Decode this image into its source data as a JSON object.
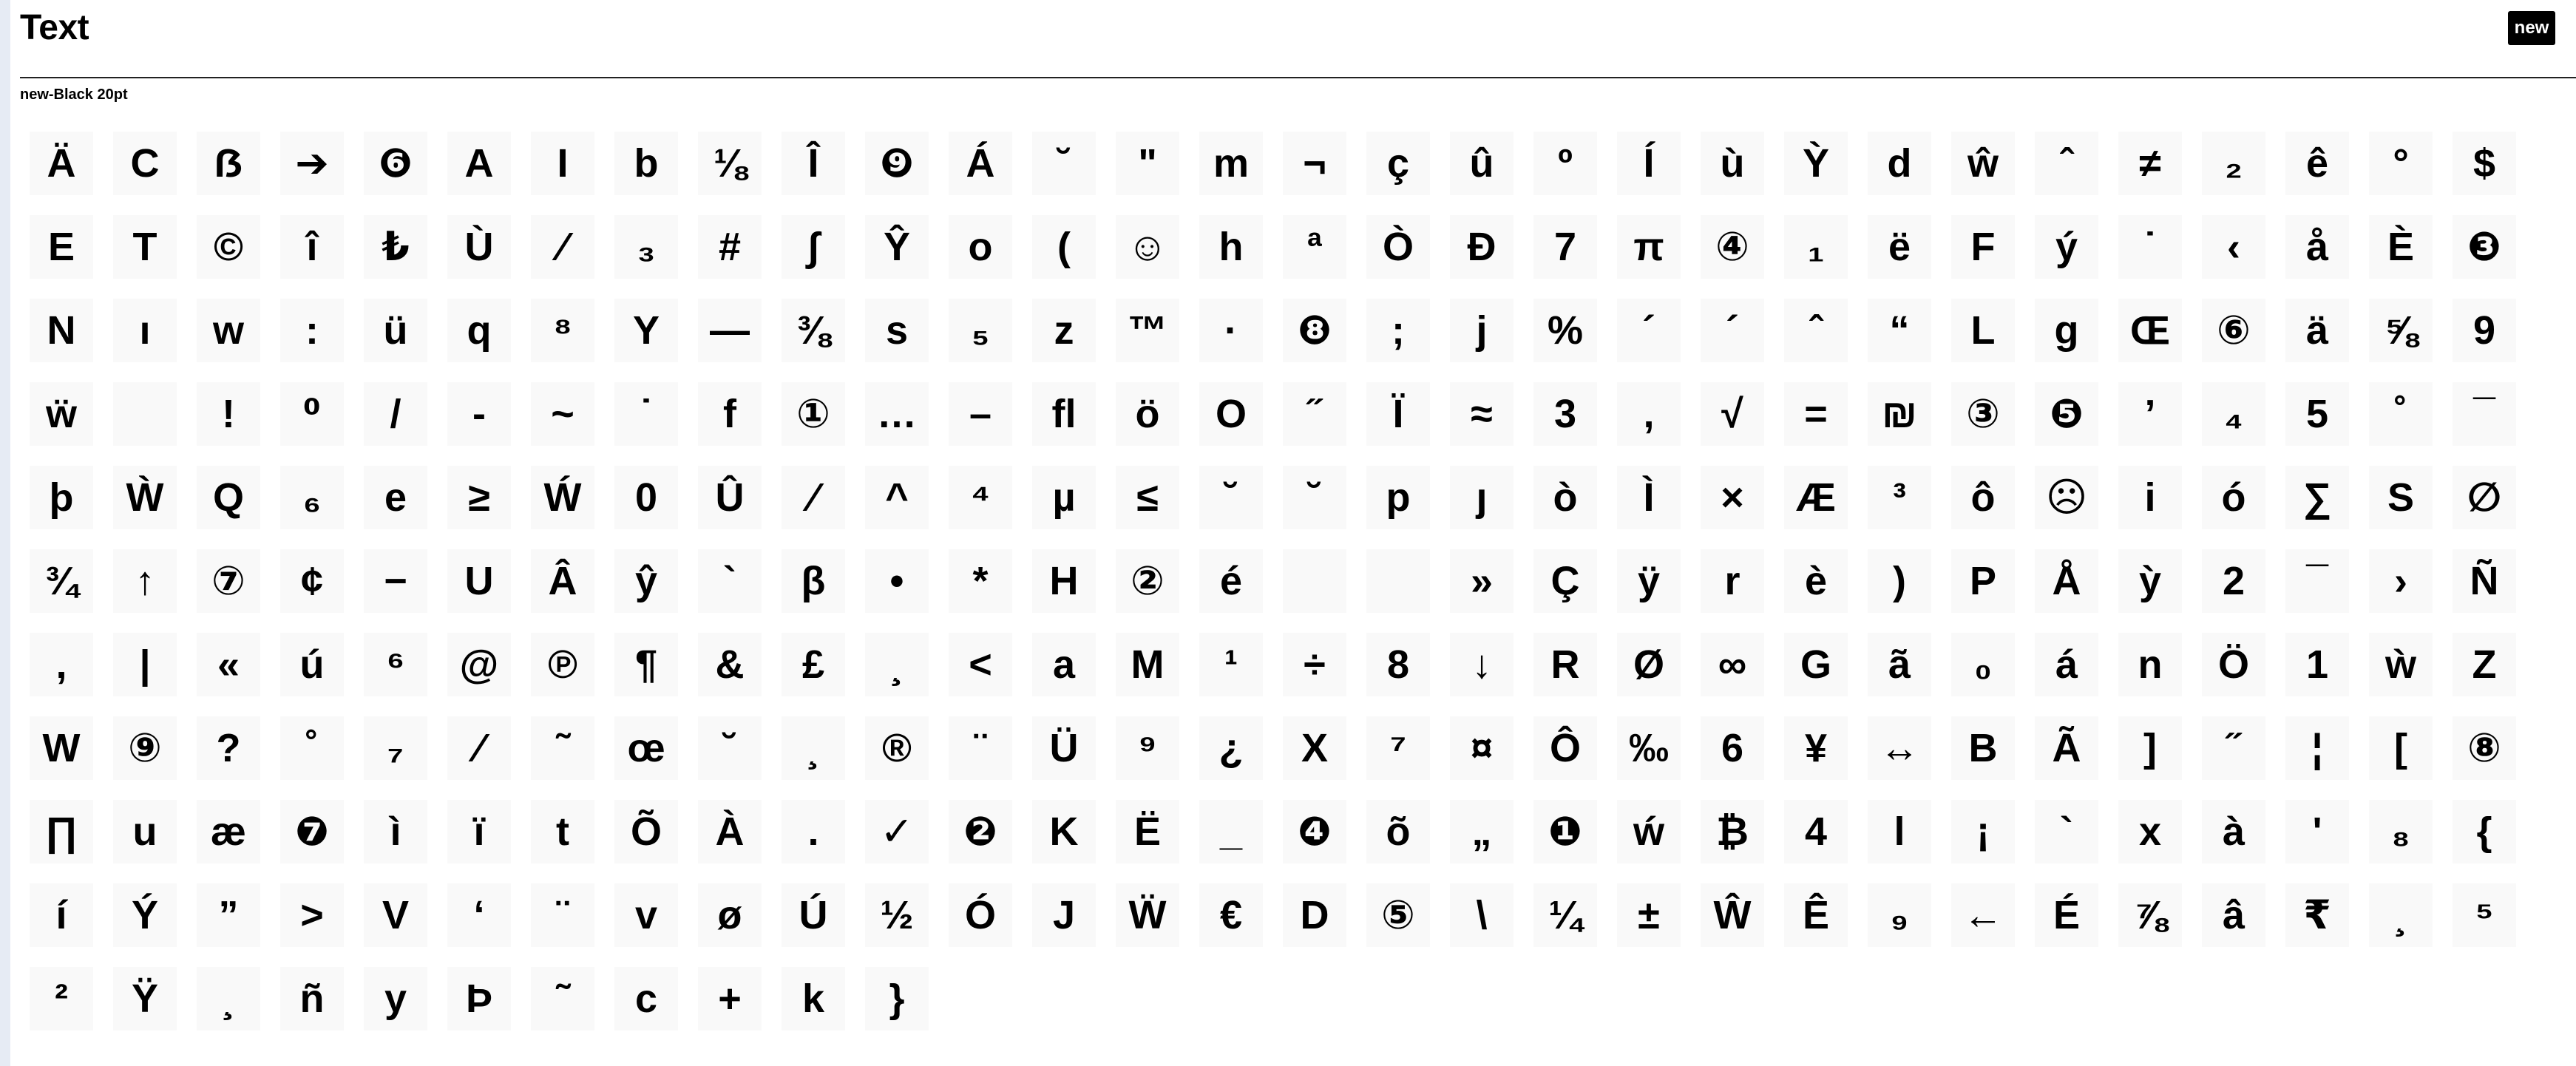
{
  "header": {
    "title": "Text",
    "badge_label": "new"
  },
  "font_label": "new-Black 20pt",
  "glyphs": [
    "Ä",
    "C",
    "ẞ",
    "➔",
    "❻",
    "A",
    "I",
    "b",
    "⅛",
    "Î",
    "❾",
    "Á",
    "˘",
    "\"",
    "m",
    "¬",
    "ç",
    "û",
    "º",
    "Í",
    "ù",
    "Ỳ",
    "d",
    "ŵ",
    "ˆ",
    "≠",
    "₂",
    "ê",
    "°",
    "$",
    "E",
    "T",
    "©",
    "î",
    "₺",
    "Ù",
    "⁄",
    "₃",
    "#",
    "∫",
    "Ŷ",
    "o",
    "(",
    "☺",
    "h",
    "ª",
    "Ò",
    "Đ",
    "7",
    "π",
    "④",
    "₁",
    "ë",
    "F",
    "ý",
    "˙",
    "‹",
    "å",
    "È",
    "❸",
    "N",
    "ı",
    "w",
    ":",
    "ü",
    "q",
    "⁸",
    "Y",
    "—",
    "⅜",
    "s",
    "₅",
    "z",
    "™",
    "·",
    "❽",
    ";",
    "j",
    "%",
    "´",
    "´",
    "ˆ",
    "“",
    "L",
    "g",
    "Œ",
    "⑥",
    "ä",
    "⅝",
    "9",
    "ẅ",
    " ",
    "!",
    "⁰",
    "/",
    "-",
    "~",
    "˙",
    "f",
    "①",
    "…",
    "–",
    "ﬂ",
    "ö",
    "O",
    "˝",
    "Ï",
    "≈",
    "3",
    ",",
    "√",
    "=",
    "₪",
    "③",
    "❺",
    "’",
    "₄",
    "5",
    "˚",
    "¯",
    "þ",
    "Ẁ",
    "Q",
    "₆",
    "e",
    "≥",
    "Ẃ",
    "0",
    "Û",
    "⁄",
    "^",
    "⁴",
    "µ",
    "≤",
    "˘",
    "˘",
    "p",
    "ȷ",
    "ò",
    "Ì",
    "×",
    "Æ",
    "³",
    "ô",
    "☹",
    "i",
    "ó",
    "∑",
    "S",
    "∅",
    "¾",
    "↑",
    "⑦",
    "¢",
    "−",
    "U",
    "Â",
    "ŷ",
    "`",
    "β",
    "•",
    "*",
    "H",
    "②",
    "é",
    " ",
    " ",
    "»",
    "Ç",
    "ÿ",
    "r",
    "è",
    ")",
    "P",
    "Å",
    "ỳ",
    "2",
    "¯",
    "›",
    "Ñ",
    ",",
    "|",
    "«",
    "ú",
    "⁶",
    "@",
    "℗",
    "¶",
    "&",
    "£",
    "¸",
    "<",
    "a",
    "M",
    "¹",
    "÷",
    "8",
    "↓",
    "R",
    "Ø",
    "∞",
    "G",
    "ã",
    "₀",
    "á",
    "n",
    "Ö",
    "1",
    "ẁ",
    "Z",
    "W",
    "⑨",
    "?",
    "˚",
    "₇",
    "⁄",
    "˜",
    "œ",
    "˘",
    "¸",
    "®",
    "¨",
    "Ü",
    "⁹",
    "¿",
    "X",
    "⁷",
    "¤",
    "Ô",
    "‰",
    "6",
    "¥",
    "↔",
    "B",
    "Ã",
    "]",
    "˝",
    "¦",
    "[",
    "⑧",
    "∏",
    "u",
    "æ",
    "❼",
    "ì",
    "ï",
    "t",
    "Õ",
    "À",
    ".",
    "✓",
    "❷",
    "K",
    "Ë",
    "_",
    "❹",
    "õ",
    "„",
    "❶",
    "ẃ",
    "₿",
    "4",
    "l",
    "¡",
    "`",
    "x",
    "à",
    "'",
    "₈",
    "{",
    "í",
    "Ý",
    "”",
    ">",
    "V",
    "‘",
    "¨",
    "v",
    "ø",
    "Ú",
    "½",
    "Ó",
    "J",
    "Ẅ",
    "€",
    "D",
    "⑤",
    "\\",
    "¼",
    "±",
    "Ŵ",
    "Ê",
    "₉",
    "←",
    "É",
    "⅞",
    "â",
    "₹",
    "¸",
    "⁵",
    "²",
    "Ÿ",
    "¸",
    "ñ",
    "y",
    "Þ",
    "˜",
    "c",
    "+",
    "k",
    "}"
  ]
}
